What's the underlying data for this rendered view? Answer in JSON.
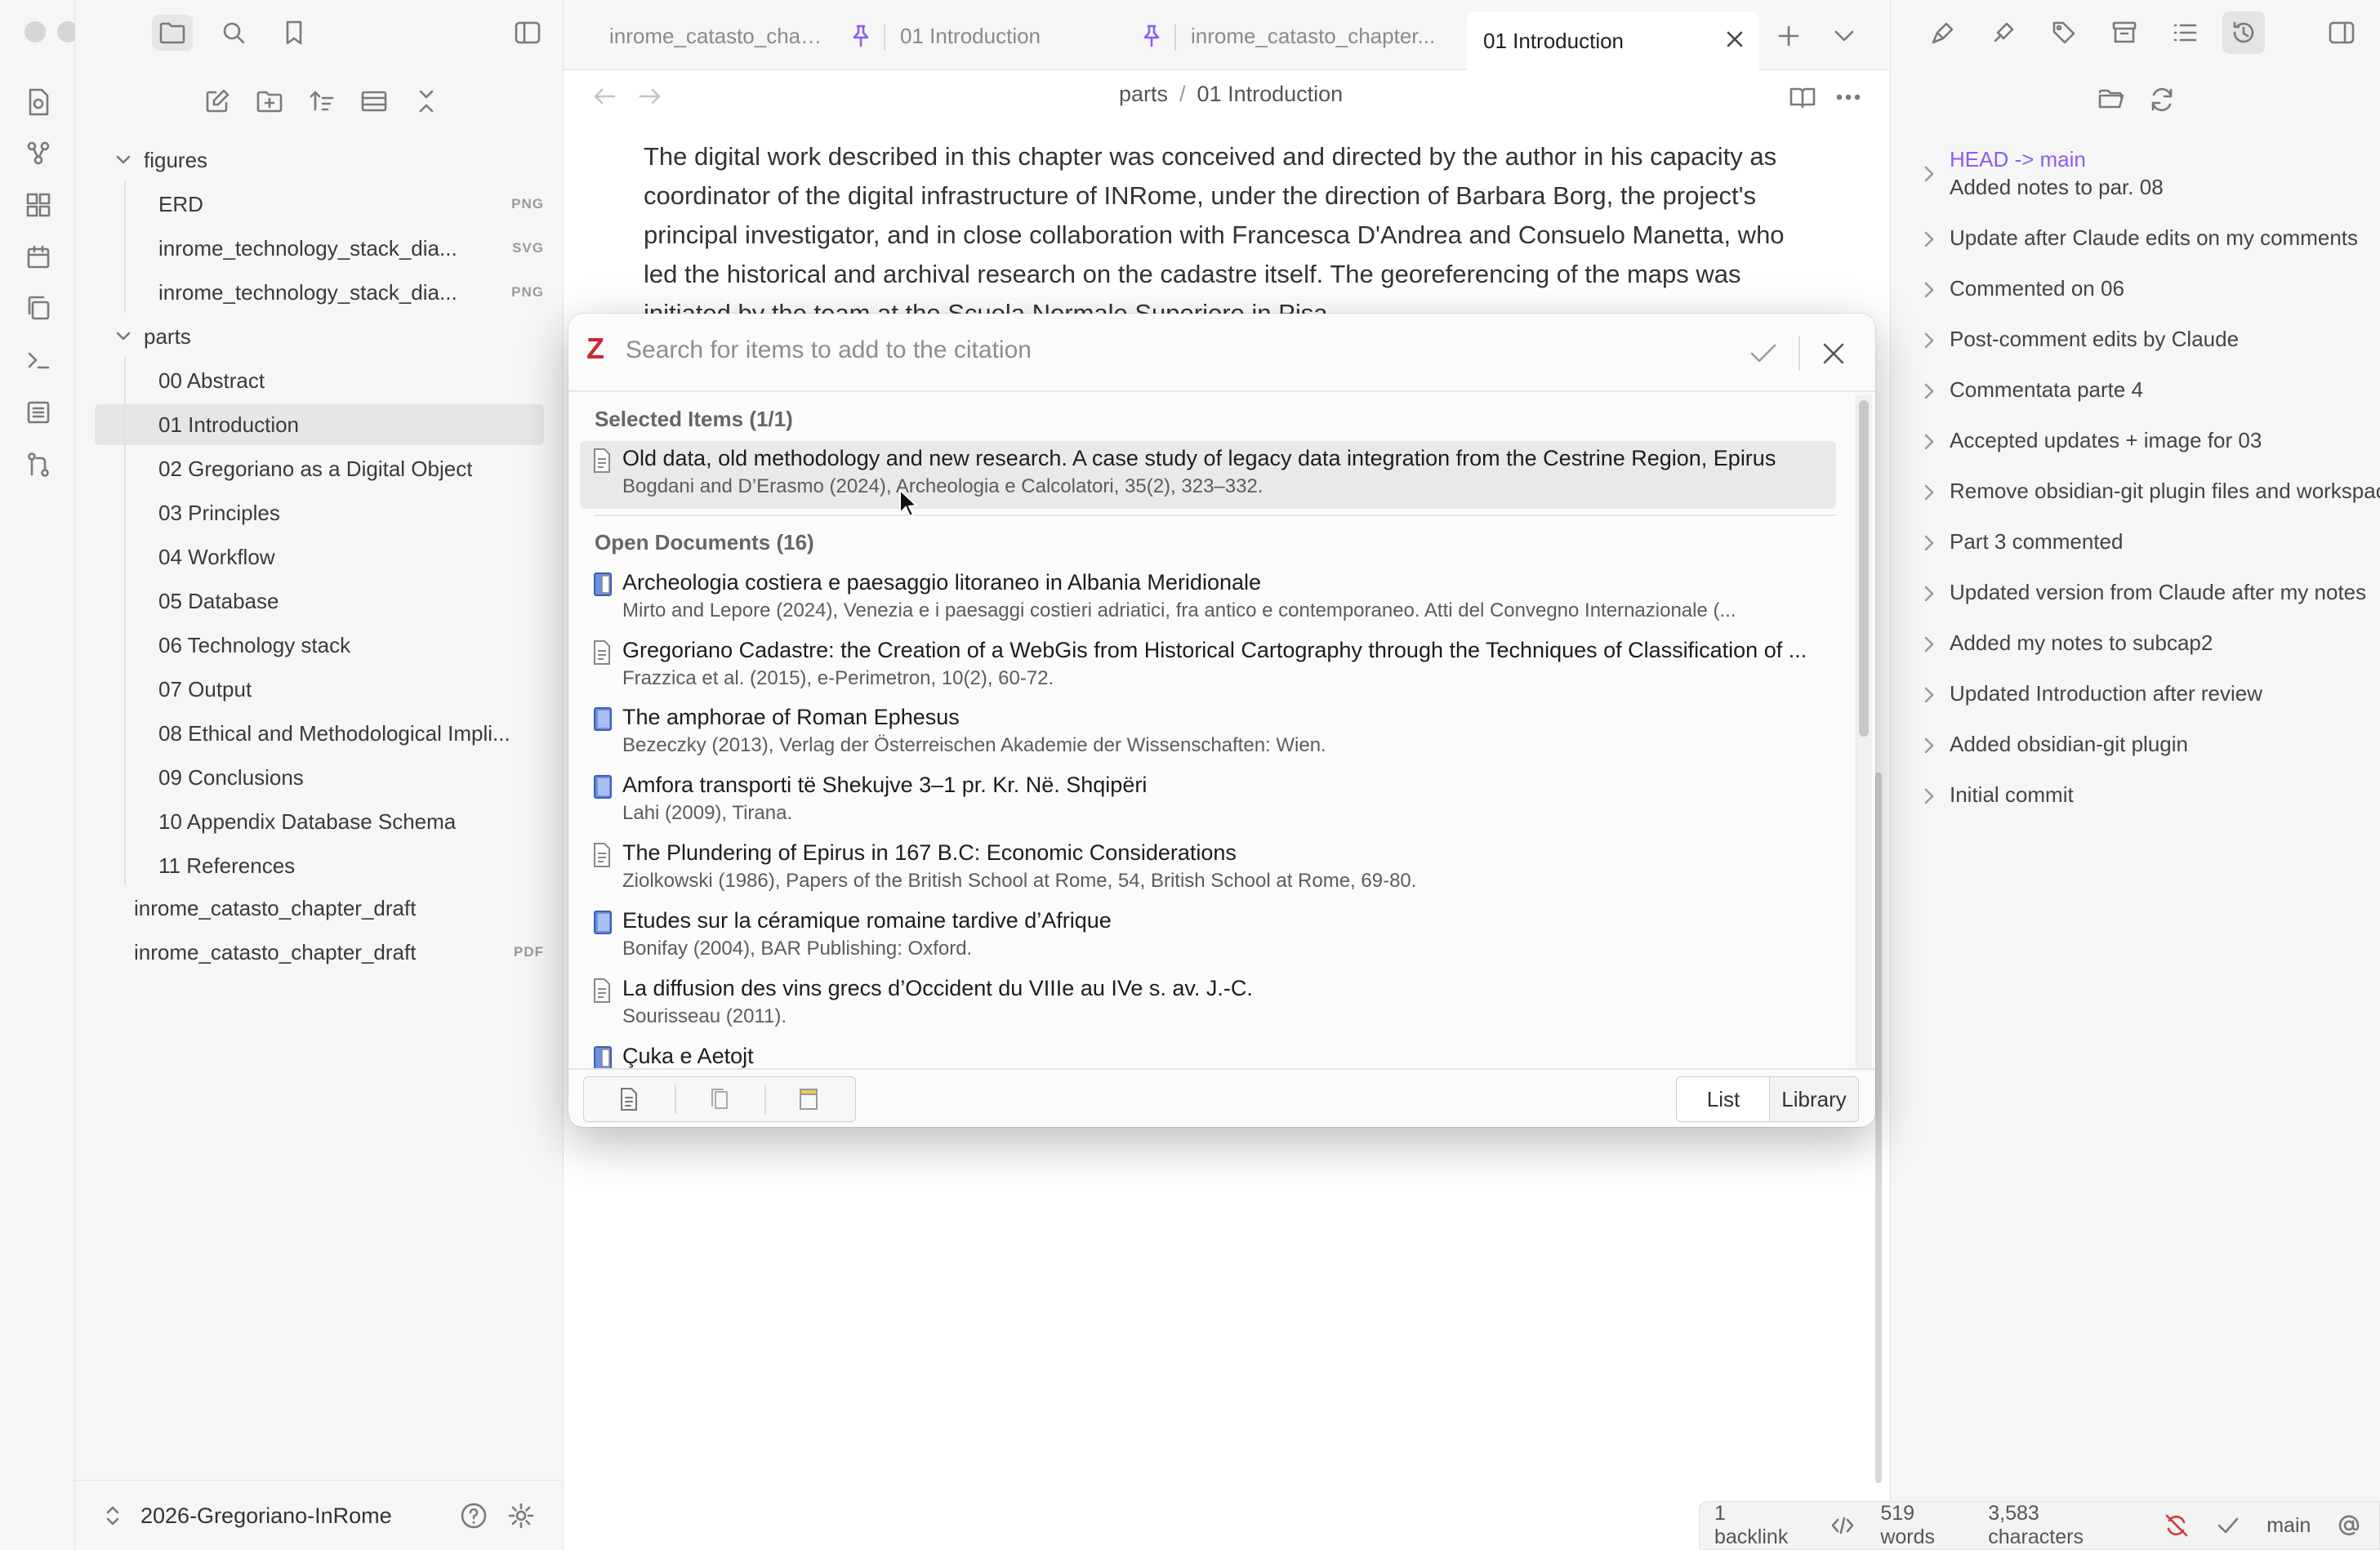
{
  "sidebar": {
    "tree": [
      {
        "name": "figures",
        "ext": "",
        "kind": "folder"
      },
      {
        "name": "ERD",
        "ext": "PNG",
        "kind": "file"
      },
      {
        "name": "inrome_technology_stack_dia...",
        "ext": "SVG",
        "kind": "file"
      },
      {
        "name": "inrome_technology_stack_dia...",
        "ext": "PNG",
        "kind": "file"
      },
      {
        "name": "parts",
        "ext": "",
        "kind": "folder"
      },
      {
        "name": "00 Abstract",
        "ext": "",
        "kind": "file"
      },
      {
        "name": "01 Introduction",
        "ext": "",
        "kind": "file",
        "active": true
      },
      {
        "name": "02 Gregoriano as a Digital Object",
        "ext": "",
        "kind": "file"
      },
      {
        "name": "03 Principles",
        "ext": "",
        "kind": "file"
      },
      {
        "name": "04 Workflow",
        "ext": "",
        "kind": "file"
      },
      {
        "name": "05 Database",
        "ext": "",
        "kind": "file"
      },
      {
        "name": "06 Technology stack",
        "ext": "",
        "kind": "file"
      },
      {
        "name": "07 Output",
        "ext": "",
        "kind": "file"
      },
      {
        "name": "08 Ethical and Methodological Impli...",
        "ext": "",
        "kind": "file"
      },
      {
        "name": "09 Conclusions",
        "ext": "",
        "kind": "file"
      },
      {
        "name": "10 Appendix Database Schema",
        "ext": "",
        "kind": "file"
      },
      {
        "name": "11 References",
        "ext": "",
        "kind": "file"
      },
      {
        "name": "inrome_catasto_chapter_draft",
        "ext": "",
        "kind": "file"
      },
      {
        "name": "inrome_catasto_chapter_draft",
        "ext": "PDF",
        "kind": "file"
      }
    ],
    "vault_name": "2026-Gregoriano-InRome"
  },
  "tabs": [
    {
      "label": "inrome_catasto_chap..."
    },
    {
      "label": "01 Introduction"
    },
    {
      "label": "inrome_catasto_chapter..."
    },
    {
      "label": "01 Introduction"
    }
  ],
  "breadcrumb": {
    "folder": "parts",
    "sep": "/",
    "file": "01 Introduction"
  },
  "editor": {
    "paragraph": "The digital work described in this chapter was conceived and directed by the author in his capacity as coordinator of the digital infrastructure of INRome, under the direction of Barbara Borg, the project's principal investigator, and in close collaboration with Francesca D'Andrea and Consuelo Manetta, who led the historical and archival research on the cadastre itself. The georeferencing of the maps was initiated by the team at the Scuola Normale Superiore in Pisa"
  },
  "dialog": {
    "logo": "Z",
    "placeholder": "Search for items to add to the citation",
    "selected_header": "Selected Items (1/1)",
    "selected": [
      {
        "title": "Old data, old methodology and new research. A case study of legacy data integration from the Cestrine Region, Epirus",
        "sub": "Bogdani and D’Erasmo (2024), Archeologia e Calcolatori, 35(2), 323–332.",
        "icon": "article"
      }
    ],
    "open_header": "Open Documents (16)",
    "open": [
      {
        "title": "Archeologia costiera e paesaggio litoraneo in Albania Meridionale",
        "sub": "Mirto and Lepore (2024), Venezia e i paesaggi costieri adriatici, fra antico e contemporaneo. Atti del Convegno Internazionale (...",
        "icon": "book-section"
      },
      {
        "title": "Gregoriano Cadastre: the Creation of a WebGis from Historical Cartography through the Techniques of Classification of ...",
        "sub": "Frazzica et al. (2015), e-Perimetron, 10(2), 60-72.",
        "icon": "article"
      },
      {
        "title": "The amphorae of Roman Ephesus",
        "sub": "Bezeczky (2013), Verlag der Österreischen Akademie der Wissenschaften: Wien.",
        "icon": "book"
      },
      {
        "title": "Amfora transporti të Shekujve 3–1 pr. Kr. Në. Shqipëri",
        "sub": "Lahi (2009), Tirana.",
        "icon": "book"
      },
      {
        "title": "The Plundering of Epirus in 167 B.C: Economic Considerations",
        "sub": "Ziolkowski (1986), Papers of the British School at Rome, 54, British School at Rome, 69-80.",
        "icon": "article"
      },
      {
        "title": "Etudes sur la céramique romaine tardive d’Afrique",
        "sub": "Bonifay (2004), BAR Publishing: Oxford.",
        "icon": "book"
      },
      {
        "title": "La diffusion des vins grecs d’Occident du VIIIe au IVe s. av. J.-C.",
        "sub": "Sourisseau (2011).",
        "icon": "article"
      },
      {
        "title": "Çuka e Aetojt",
        "sub": "",
        "icon": "book-section"
      }
    ],
    "btn_list": "List",
    "btn_library": "Library"
  },
  "git": {
    "head_label": "HEAD -> main",
    "commits": [
      "Added notes to par. 08",
      "Update after Claude edits on my comments",
      "Commented on 06",
      "Post-comment edits by Claude",
      "Commentata parte 4",
      "Accepted updates + image for 03",
      "Remove obsidian-git plugin files and workspace",
      "Part 3 commented",
      "Updated version from Claude after my notes",
      "Added my notes to subcap2",
      "Updated Introduction after review",
      "Added obsidian-git plugin",
      "Initial commit"
    ]
  },
  "status": {
    "backlinks": "1 backlink",
    "words": "519 words",
    "chars": "3,583 characters",
    "branch": "main"
  },
  "colors": {
    "accent": "#8a5cf5",
    "zotero_red": "#cc2936"
  }
}
